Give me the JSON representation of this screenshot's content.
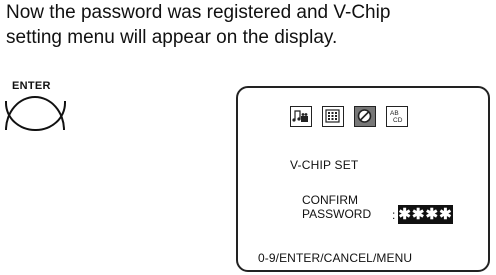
{
  "instruction": {
    "line1": "Now the password was registered and V-Chip",
    "line2": "setting menu will appear on the display."
  },
  "remote": {
    "button_label": "ENTER"
  },
  "screen": {
    "icons": [
      "music-film-icon",
      "keypad-icon",
      "block-icon",
      "abcd-icon"
    ],
    "active_icon": "block-icon",
    "menu_title": "V-CHIP  SET",
    "confirm_line1": "CONFIRM",
    "confirm_line2": "PASSWORD",
    "colon": ":",
    "password_masked": "✱✱✱✱",
    "footer": "0-9/ENTER/CANCEL/MENU"
  }
}
